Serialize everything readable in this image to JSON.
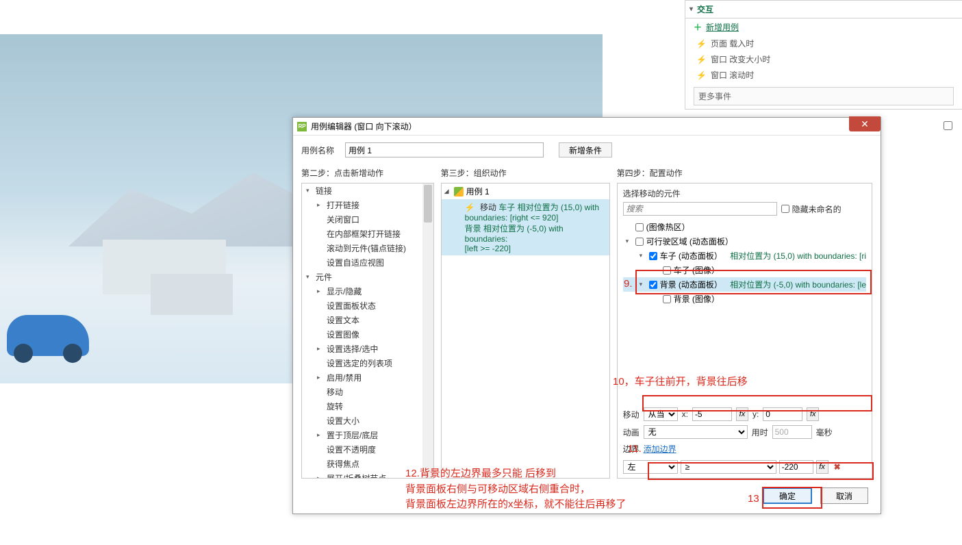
{
  "right_panel": {
    "interact_header": "交互",
    "add_case": "新增用例",
    "events": [
      "页面 载入时",
      "窗口 改变大小时",
      "窗口 滚动时"
    ],
    "more_events": "更多事件"
  },
  "dialog": {
    "title": "用例编辑器 (窗口 向下滚动）",
    "name_label": "用例名称",
    "name_value": "用例 1",
    "add_condition": "新增条件",
    "step2_title": "第二步：点击新增动作",
    "step3_title": "第三步：组织动作",
    "step4_title": "第四步：配置动作",
    "step2_tree": {
      "links": {
        "label": "链接",
        "items": [
          "打开链接",
          "关闭窗口",
          "在内部框架打开链接",
          "滚动到元件(锚点链接)",
          "设置自适应视图"
        ]
      },
      "widgets": {
        "label": "元件",
        "items": [
          "显示/隐藏",
          "设置面板状态",
          "设置文本",
          "设置图像",
          "设置选择/选中",
          "设置选定的列表项",
          "启用/禁用",
          "移动",
          "旋转",
          "设置大小",
          "置于顶层/底层",
          "设置不透明度",
          "获得焦点",
          "展开/折叠树节点"
        ]
      }
    },
    "step3": {
      "case_label": "用例 1",
      "action_prefix": "移动 ",
      "widget_car": "车子",
      "rel_pos_car": " 相对位置为 (15,0) ",
      "withb": "with",
      "bound_car": "boundaries: [right <= 920]",
      "comma": " , ",
      "widget_bg": "背景",
      "rel_pos_bg": " 相对位置为 (-5,0) ",
      "withb2": "with boundaries:",
      "bound_bg": "[left >= -220]"
    },
    "step4": {
      "subtitle": "选择移动的元件",
      "search_placeholder": "搜索",
      "hide_unnamed": "隐藏未命名的",
      "tree": {
        "hotspot": "(图像热区）",
        "drivable": {
          "label": "可行驶区域 (动态面板）"
        },
        "car_panel": {
          "label": "车子 (动态面板）",
          "suffix": "相对位置为 (15,0)  with boundaries: [ri"
        },
        "car_img": "车子 (图像）",
        "bg_panel": {
          "label": "背景 (动态面板）",
          "suffix": "相对位置为 (-5,0)  with boundaries: [le"
        },
        "bg_img": "背景 (图像）"
      },
      "move_label": "移动",
      "move_mode": "从当前",
      "x_label": "x:",
      "x_value": "-5",
      "y_label": "y:",
      "y_value": "0",
      "anim_label": "动画",
      "anim_value": "无",
      "dur_label": "用时",
      "dur_value": "500",
      "dur_unit": "毫秒",
      "bound_label": "边界",
      "add_bound": "添加边界",
      "bound_side": "左",
      "bound_op": "≥",
      "bound_val": "-220"
    },
    "ok": "确定",
    "cancel": "取消"
  },
  "annotations": {
    "n9": "9.",
    "n10": "10，车子往前开，背景往后移",
    "n11": "11.",
    "n12": "12.背景的左边界最多只能 后移到\n背景面板右侧与可移动区域右侧重合时，\n背景面板左边界所在的x坐标，就不能往后再移了",
    "n13": "13"
  }
}
